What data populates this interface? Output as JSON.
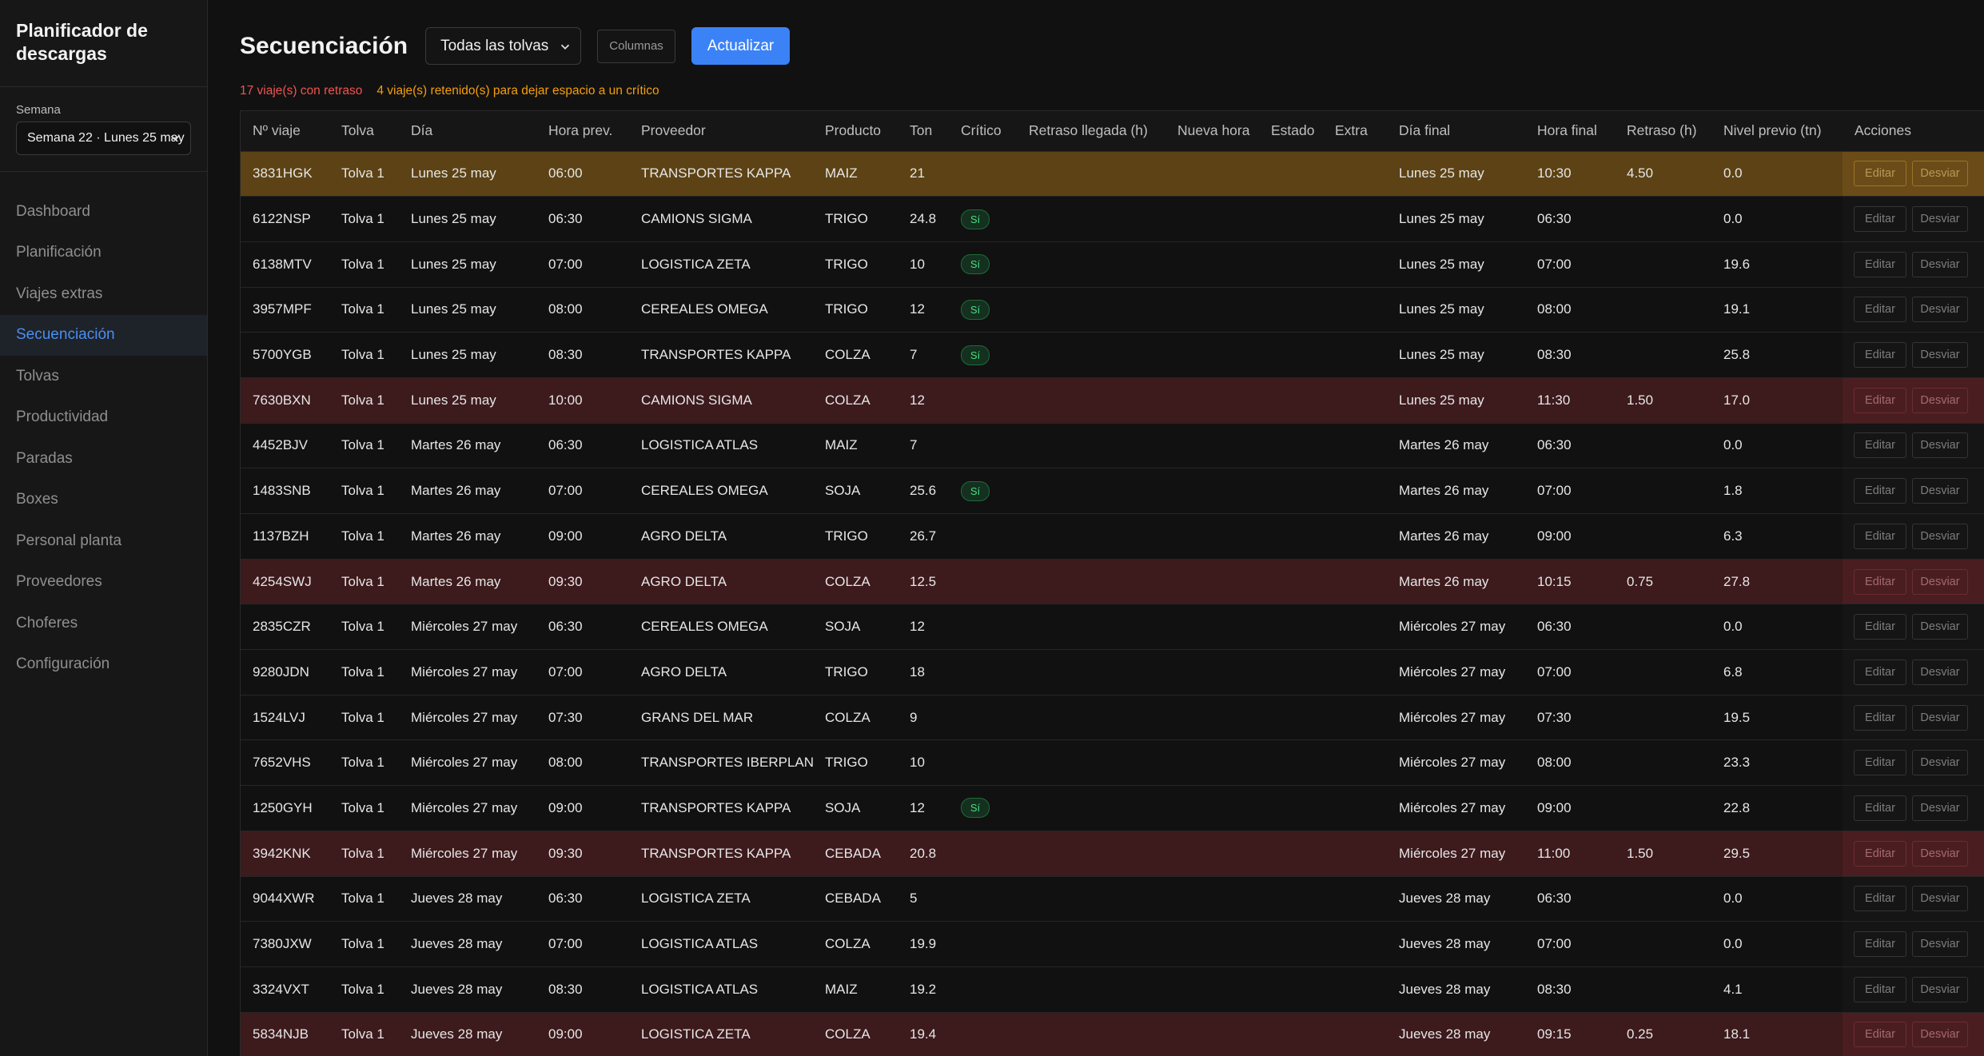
{
  "sidebar": {
    "brand": "Planificador de descargas",
    "week_label": "Semana",
    "week_value": "Semana 22 · Lunes 25 may",
    "items": [
      {
        "label": "Dashboard"
      },
      {
        "label": "Planificación"
      },
      {
        "label": "Viajes extras"
      },
      {
        "label": "Secuenciación"
      },
      {
        "label": "Tolvas"
      },
      {
        "label": "Productividad"
      },
      {
        "label": "Paradas"
      },
      {
        "label": "Boxes"
      },
      {
        "label": "Personal planta"
      },
      {
        "label": "Proveedores"
      },
      {
        "label": "Choferes"
      },
      {
        "label": "Configuración"
      }
    ],
    "active_index": 3
  },
  "header": {
    "title": "Secuenciación",
    "tolva_filter": "Todas las tolvas",
    "columns_label": "Columnas",
    "refresh_label": "Actualizar"
  },
  "alerts": {
    "delay_text": "17 viaje(s) con retraso",
    "held_text": "4 viaje(s) retenido(s) para dejar espacio a un crítico"
  },
  "colors": {
    "accent": "#3b82f6",
    "delayed_row": "#3d1a1c",
    "held_row": "#5c4214",
    "critical_badge": "#4ade80"
  },
  "table": {
    "columns": [
      "Nº viaje",
      "Tolva",
      "Día",
      "Hora prev.",
      "Proveedor",
      "Producto",
      "Ton",
      "Crítico",
      "Retraso llegada (h)",
      "Nueva hora",
      "Estado",
      "Extra",
      "Día final",
      "Hora final",
      "Retraso (h)",
      "Nivel previo (tn)",
      "Acciones"
    ],
    "edit_label": "Editar",
    "divert_label": "Desviar",
    "rows": [
      {
        "status": "held",
        "trip": "3831HGK",
        "tolva": "Tolva 1",
        "day": "Lunes 25 may",
        "time": "06:00",
        "supplier": "TRANSPORTES KAPPA",
        "product": "MAIZ",
        "ton": "21",
        "critical": "",
        "arrival_delay": "",
        "new_time": "",
        "state": "",
        "extra": "",
        "final_day": "Lunes 25 may",
        "final_time": "10:30",
        "delay": "4.50",
        "prev_level": "0.0"
      },
      {
        "status": "normal",
        "trip": "6122NSP",
        "tolva": "Tolva 1",
        "day": "Lunes 25 may",
        "time": "06:30",
        "supplier": "CAMIONS SIGMA",
        "product": "TRIGO",
        "ton": "24.8",
        "critical": "Sí",
        "arrival_delay": "",
        "new_time": "",
        "state": "",
        "extra": "",
        "final_day": "Lunes 25 may",
        "final_time": "06:30",
        "delay": "",
        "prev_level": "0.0"
      },
      {
        "status": "normal",
        "trip": "6138MTV",
        "tolva": "Tolva 1",
        "day": "Lunes 25 may",
        "time": "07:00",
        "supplier": "LOGISTICA ZETA",
        "product": "TRIGO",
        "ton": "10",
        "critical": "Sí",
        "arrival_delay": "",
        "new_time": "",
        "state": "",
        "extra": "",
        "final_day": "Lunes 25 may",
        "final_time": "07:00",
        "delay": "",
        "prev_level": "19.6"
      },
      {
        "status": "normal",
        "trip": "3957MPF",
        "tolva": "Tolva 1",
        "day": "Lunes 25 may",
        "time": "08:00",
        "supplier": "CEREALES OMEGA",
        "product": "TRIGO",
        "ton": "12",
        "critical": "Sí",
        "arrival_delay": "",
        "new_time": "",
        "state": "",
        "extra": "",
        "final_day": "Lunes 25 may",
        "final_time": "08:00",
        "delay": "",
        "prev_level": "19.1"
      },
      {
        "status": "normal",
        "trip": "5700YGB",
        "tolva": "Tolva 1",
        "day": "Lunes 25 may",
        "time": "08:30",
        "supplier": "TRANSPORTES KAPPA",
        "product": "COLZA",
        "ton": "7",
        "critical": "Sí",
        "arrival_delay": "",
        "new_time": "",
        "state": "",
        "extra": "",
        "final_day": "Lunes 25 may",
        "final_time": "08:30",
        "delay": "",
        "prev_level": "25.8"
      },
      {
        "status": "delayed",
        "trip": "7630BXN",
        "tolva": "Tolva 1",
        "day": "Lunes 25 may",
        "time": "10:00",
        "supplier": "CAMIONS SIGMA",
        "product": "COLZA",
        "ton": "12",
        "critical": "",
        "arrival_delay": "",
        "new_time": "",
        "state": "",
        "extra": "",
        "final_day": "Lunes 25 may",
        "final_time": "11:30",
        "delay": "1.50",
        "prev_level": "17.0"
      },
      {
        "status": "normal",
        "trip": "4452BJV",
        "tolva": "Tolva 1",
        "day": "Martes 26 may",
        "time": "06:30",
        "supplier": "LOGISTICA ATLAS",
        "product": "MAIZ",
        "ton": "7",
        "critical": "",
        "arrival_delay": "",
        "new_time": "",
        "state": "",
        "extra": "",
        "final_day": "Martes 26 may",
        "final_time": "06:30",
        "delay": "",
        "prev_level": "0.0"
      },
      {
        "status": "normal",
        "trip": "1483SNB",
        "tolva": "Tolva 1",
        "day": "Martes 26 may",
        "time": "07:00",
        "supplier": "CEREALES OMEGA",
        "product": "SOJA",
        "ton": "25.6",
        "critical": "Sí",
        "arrival_delay": "",
        "new_time": "",
        "state": "",
        "extra": "",
        "final_day": "Martes 26 may",
        "final_time": "07:00",
        "delay": "",
        "prev_level": "1.8"
      },
      {
        "status": "normal",
        "trip": "1137BZH",
        "tolva": "Tolva 1",
        "day": "Martes 26 may",
        "time": "09:00",
        "supplier": "AGRO DELTA",
        "product": "TRIGO",
        "ton": "26.7",
        "critical": "",
        "arrival_delay": "",
        "new_time": "",
        "state": "",
        "extra": "",
        "final_day": "Martes 26 may",
        "final_time": "09:00",
        "delay": "",
        "prev_level": "6.3"
      },
      {
        "status": "delayed",
        "trip": "4254SWJ",
        "tolva": "Tolva 1",
        "day": "Martes 26 may",
        "time": "09:30",
        "supplier": "AGRO DELTA",
        "product": "COLZA",
        "ton": "12.5",
        "critical": "",
        "arrival_delay": "",
        "new_time": "",
        "state": "",
        "extra": "",
        "final_day": "Martes 26 may",
        "final_time": "10:15",
        "delay": "0.75",
        "prev_level": "27.8"
      },
      {
        "status": "normal",
        "trip": "2835CZR",
        "tolva": "Tolva 1",
        "day": "Miércoles 27 may",
        "time": "06:30",
        "supplier": "CEREALES OMEGA",
        "product": "SOJA",
        "ton": "12",
        "critical": "",
        "arrival_delay": "",
        "new_time": "",
        "state": "",
        "extra": "",
        "final_day": "Miércoles 27 may",
        "final_time": "06:30",
        "delay": "",
        "prev_level": "0.0"
      },
      {
        "status": "normal",
        "trip": "9280JDN",
        "tolva": "Tolva 1",
        "day": "Miércoles 27 may",
        "time": "07:00",
        "supplier": "AGRO DELTA",
        "product": "TRIGO",
        "ton": "18",
        "critical": "",
        "arrival_delay": "",
        "new_time": "",
        "state": "",
        "extra": "",
        "final_day": "Miércoles 27 may",
        "final_time": "07:00",
        "delay": "",
        "prev_level": "6.8"
      },
      {
        "status": "normal",
        "trip": "1524LVJ",
        "tolva": "Tolva 1",
        "day": "Miércoles 27 may",
        "time": "07:30",
        "supplier": "GRANS DEL MAR",
        "product": "COLZA",
        "ton": "9",
        "critical": "",
        "arrival_delay": "",
        "new_time": "",
        "state": "",
        "extra": "",
        "final_day": "Miércoles 27 may",
        "final_time": "07:30",
        "delay": "",
        "prev_level": "19.5"
      },
      {
        "status": "normal",
        "trip": "7652VHS",
        "tolva": "Tolva 1",
        "day": "Miércoles 27 may",
        "time": "08:00",
        "supplier": "TRANSPORTES IBERPLAN",
        "product": "TRIGO",
        "ton": "10",
        "critical": "",
        "arrival_delay": "",
        "new_time": "",
        "state": "",
        "extra": "",
        "final_day": "Miércoles 27 may",
        "final_time": "08:00",
        "delay": "",
        "prev_level": "23.3"
      },
      {
        "status": "normal",
        "trip": "1250GYH",
        "tolva": "Tolva 1",
        "day": "Miércoles 27 may",
        "time": "09:00",
        "supplier": "TRANSPORTES KAPPA",
        "product": "SOJA",
        "ton": "12",
        "critical": "Sí",
        "arrival_delay": "",
        "new_time": "",
        "state": "",
        "extra": "",
        "final_day": "Miércoles 27 may",
        "final_time": "09:00",
        "delay": "",
        "prev_level": "22.8"
      },
      {
        "status": "delayed",
        "trip": "3942KNK",
        "tolva": "Tolva 1",
        "day": "Miércoles 27 may",
        "time": "09:30",
        "supplier": "TRANSPORTES KAPPA",
        "product": "CEBADA",
        "ton": "20.8",
        "critical": "",
        "arrival_delay": "",
        "new_time": "",
        "state": "",
        "extra": "",
        "final_day": "Miércoles 27 may",
        "final_time": "11:00",
        "delay": "1.50",
        "prev_level": "29.5"
      },
      {
        "status": "normal",
        "trip": "9044XWR",
        "tolva": "Tolva 1",
        "day": "Jueves 28 may",
        "time": "06:30",
        "supplier": "LOGISTICA ZETA",
        "product": "CEBADA",
        "ton": "5",
        "critical": "",
        "arrival_delay": "",
        "new_time": "",
        "state": "",
        "extra": "",
        "final_day": "Jueves 28 may",
        "final_time": "06:30",
        "delay": "",
        "prev_level": "0.0"
      },
      {
        "status": "normal",
        "trip": "7380JXW",
        "tolva": "Tolva 1",
        "day": "Jueves 28 may",
        "time": "07:00",
        "supplier": "LOGISTICA ATLAS",
        "product": "COLZA",
        "ton": "19.9",
        "critical": "",
        "arrival_delay": "",
        "new_time": "",
        "state": "",
        "extra": "",
        "final_day": "Jueves 28 may",
        "final_time": "07:00",
        "delay": "",
        "prev_level": "0.0"
      },
      {
        "status": "normal",
        "trip": "3324VXT",
        "tolva": "Tolva 1",
        "day": "Jueves 28 may",
        "time": "08:30",
        "supplier": "LOGISTICA ATLAS",
        "product": "MAIZ",
        "ton": "19.2",
        "critical": "",
        "arrival_delay": "",
        "new_time": "",
        "state": "",
        "extra": "",
        "final_day": "Jueves 28 may",
        "final_time": "08:30",
        "delay": "",
        "prev_level": "4.1"
      },
      {
        "status": "delayed",
        "trip": "5834NJB",
        "tolva": "Tolva 1",
        "day": "Jueves 28 may",
        "time": "09:00",
        "supplier": "LOGISTICA ZETA",
        "product": "COLZA",
        "ton": "19.4",
        "critical": "",
        "arrival_delay": "",
        "new_time": "",
        "state": "",
        "extra": "",
        "final_day": "Jueves 28 may",
        "final_time": "09:15",
        "delay": "0.25",
        "prev_level": "18.1"
      }
    ]
  }
}
